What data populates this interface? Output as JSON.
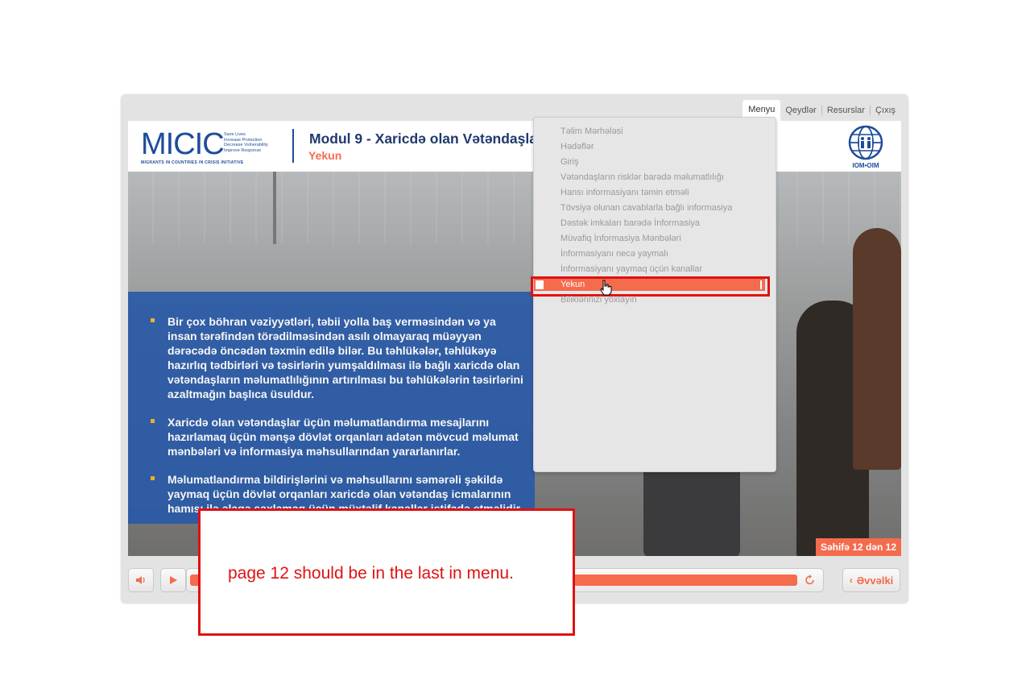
{
  "nav": {
    "items": [
      "Menyu",
      "Qeydlər",
      "Resurslar",
      "Çıxış"
    ]
  },
  "header": {
    "logo_text": "MICIC",
    "logo_taglines": [
      "Save Lives",
      "Increase Protection",
      "Decrease Vulnerability",
      "Improve Response"
    ],
    "logo_subtitle": "MIGRANTS IN COUNTRIES IN CRISIS INITIATIVE",
    "title": "Modul 9 - Xaricdə olan Vətəndaşların",
    "title_tail": "ı",
    "subtitle": "Yekun",
    "iom_label": "IOM•OIM"
  },
  "slide": {
    "bullets": [
      "Bir çox böhran vəziyyətləri, təbii yolla baş verməsindən və ya insan tərəfindən törədilməsindən asılı olmayaraq müəyyən dərəcədə öncədən təxmin edilə bilər. Bu təhlükələr, təhlükəyə hazırlıq tədbirləri və təsirlərin yumşaldılması ilə bağlı xaricdə olan vətəndaşların məlumatlılığının artırılması bu təhlükələrin təsirlərini  azaltmağın başlıca üsuldur.",
      " Xaricdə olan vətəndaşlar üçün məlumatlandırma mesajlarını hazırlamaq üçün mənşə dövlət  orqanları adətən mövcud məlumat mənbələri və informasiya məhsullarından yararlanırlar.",
      "Məlumatlandırma bildirişlərini  və  məhsullarını səmərəli şəkildə yaymaq üçün dövlət orqanları xaricdə olan vətəndaş icmalarının hamısı ilə əlaqə saxlamaq üçün müxtəlif  kanallar istifadə etməlidir"
    ],
    "page_indicator": "Səhifə 12 dən 12"
  },
  "menu": {
    "items": [
      "Təlim Mərhələsi",
      "Hədəflər",
      "Giriş",
      "Vətəndaşların risklər barədə məlumatlılığı",
      "Hansı informasiyanı təmin etməli",
      "Tövsiyə olunan cavablarla bağlı informasiya",
      " Dəstək imkaları barədə İnformasiya",
      "Müvafiq İnformasiya Mənbələri",
      "İnformasiyanı necə yaymalı",
      "İnformasiyanı yaymaq üçün kanallar",
      "Yekun",
      "Biliklərinizi yoxlayın"
    ],
    "selected_index": 10
  },
  "controls": {
    "prev_label": "Əvvəlki",
    "progress": 1.0
  },
  "annotation": {
    "text": "page 12 should be in the last in menu."
  },
  "colors": {
    "accent": "#f46b4e",
    "brand_blue": "#1f4c9b",
    "annotation_red": "#e01212"
  }
}
